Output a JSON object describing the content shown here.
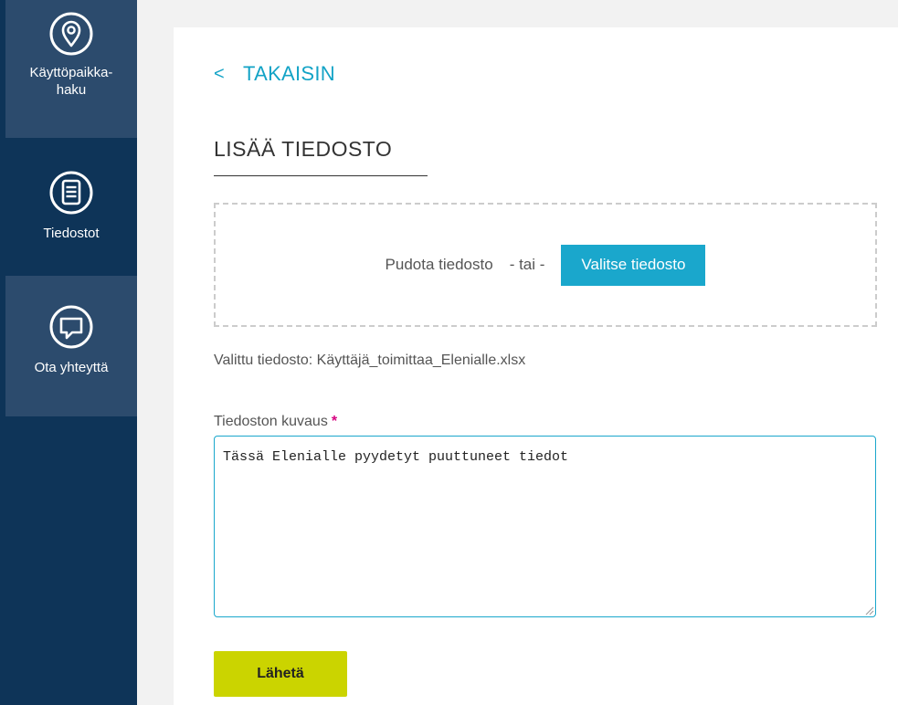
{
  "sidebar": {
    "items": [
      {
        "label_line1": "Käyttöpaikka-",
        "label_line2": "haku",
        "icon": "location-pin-icon"
      },
      {
        "label": "Tiedostot",
        "icon": "document-list-icon"
      },
      {
        "label": "Ota yhteyttä",
        "icon": "chat-bubble-icon"
      }
    ]
  },
  "main": {
    "back_chevron": "<",
    "back_label": "TAKAISIN",
    "title": "LISÄÄ TIEDOSTO",
    "dropzone": {
      "drop_text": "Pudota tiedosto",
      "or_text": "- tai -",
      "choose_button": "Valitse tiedosto"
    },
    "selected_file": "Valittu tiedosto: Käyttäjä_toimittaa_Elenialle.xlsx",
    "description": {
      "label": "Tiedoston kuvaus",
      "required_mark": "*",
      "value": "Tässä Elenialle pyydetyt puuttuneet tiedot"
    },
    "submit_button": "Lähetä"
  },
  "colors": {
    "sidebar_bg": "#0e3458",
    "sidebar_item_light": "#2c4b6d",
    "accent": "#1aa7cc",
    "submit": "#cbd400",
    "required": "#d6007f"
  }
}
